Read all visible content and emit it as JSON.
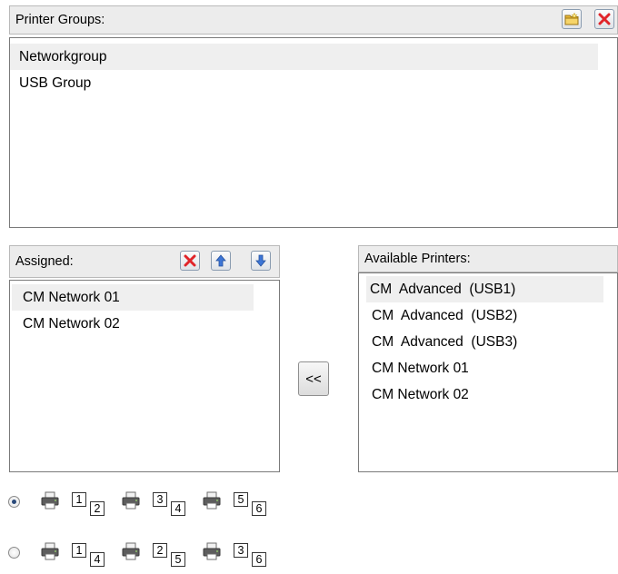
{
  "printer_groups": {
    "label": "Printer Groups:",
    "items": [
      "Networkgroup",
      "USB Group"
    ],
    "selected_index": 0,
    "toolbar": [
      "new-folder-icon",
      "delete-icon"
    ]
  },
  "assigned": {
    "label": "Assigned:",
    "items": [
      "CM Network 01",
      "CM Network 02"
    ],
    "selected_index": 0,
    "toolbar": [
      "delete-icon",
      "arrow-up-icon",
      "arrow-down-icon"
    ]
  },
  "available": {
    "label": "Available Printers:",
    "items": [
      "CM  Advanced  (USB1)",
      "CM  Advanced  (USB2)",
      "CM  Advanced  (USB3)",
      "CM Network 01",
      "CM Network 02"
    ],
    "selected_index": 0
  },
  "move_button_label": "<<",
  "layout_options": [
    {
      "selected": true,
      "pairs": [
        [
          "1",
          "2"
        ],
        [
          "3",
          "4"
        ],
        [
          "5",
          "6"
        ]
      ]
    },
    {
      "selected": false,
      "pairs": [
        [
          "1",
          "4"
        ],
        [
          "2",
          "5"
        ],
        [
          "3",
          "6"
        ]
      ]
    }
  ],
  "colors": {
    "header_bg": "#ececec",
    "selection_bg": "#efefef",
    "delete_red": "#e0242a",
    "arrow_blue": "#3d76d6"
  }
}
